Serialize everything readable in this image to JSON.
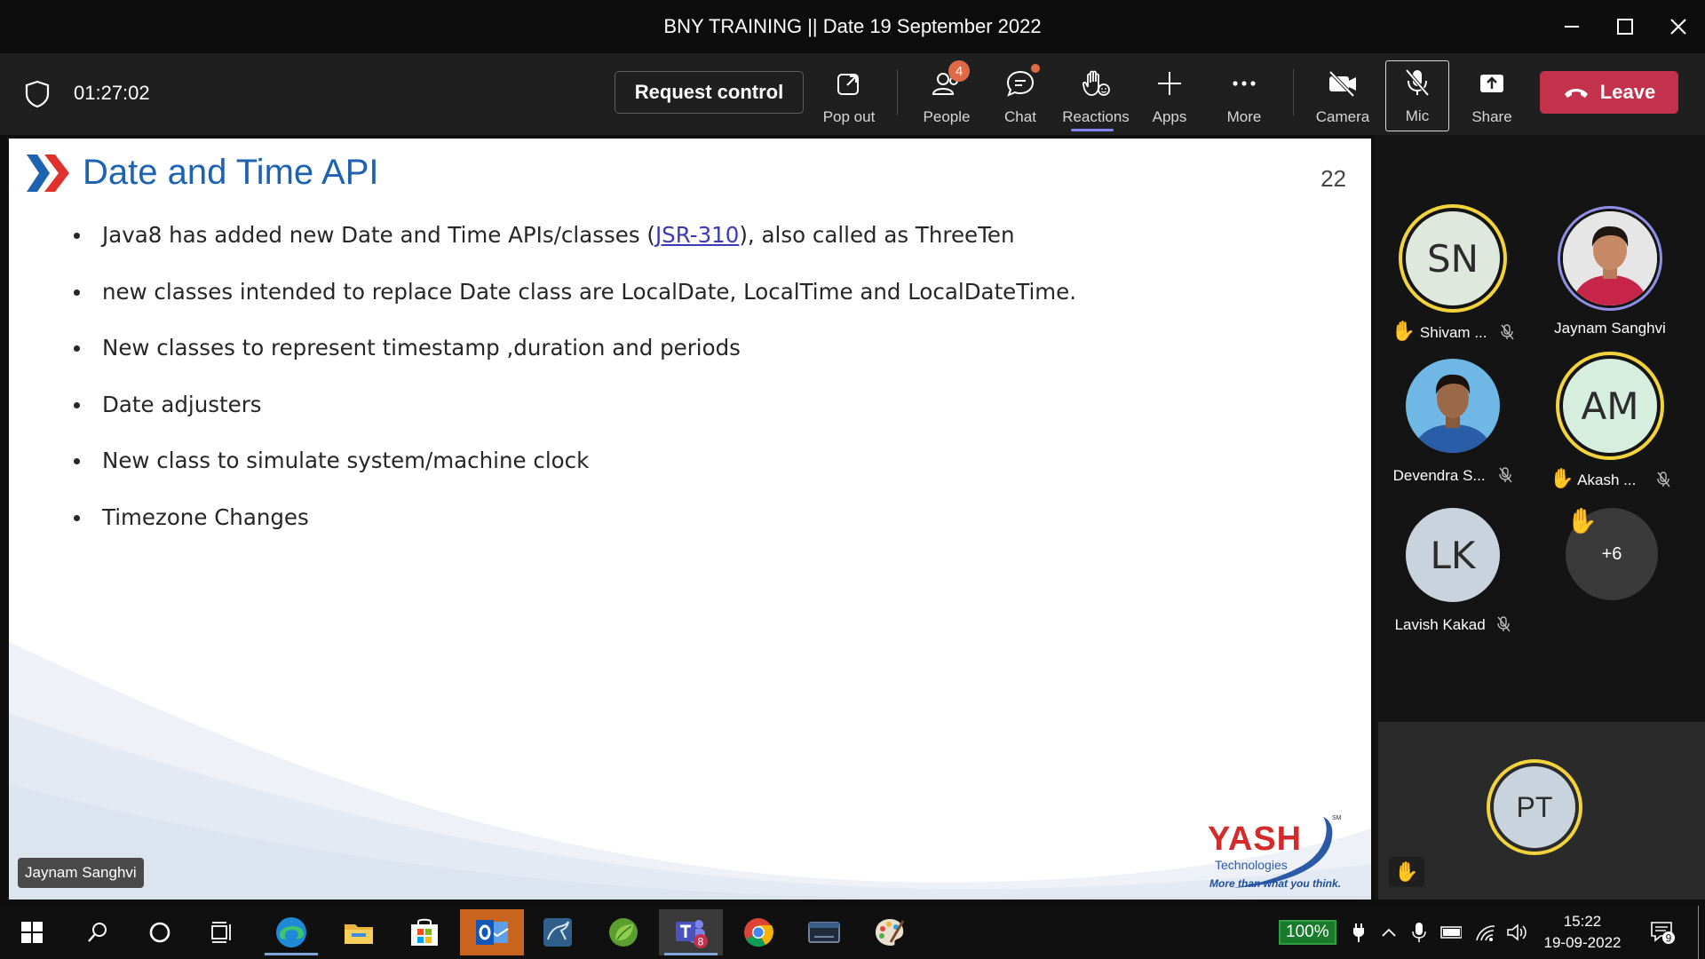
{
  "window": {
    "title": "BNY TRAINING || Date 19 September 2022"
  },
  "toolbar": {
    "timer": "01:27:02",
    "request_control": "Request control",
    "items": [
      {
        "label": "Pop out",
        "icon": "pop-out-icon"
      },
      {
        "label": "People",
        "icon": "people-icon",
        "badge": "4"
      },
      {
        "label": "Chat",
        "icon": "chat-icon"
      },
      {
        "label": "Reactions",
        "icon": "reactions-icon"
      },
      {
        "label": "Apps",
        "icon": "apps-icon"
      },
      {
        "label": "More",
        "icon": "more-icon"
      },
      {
        "label": "Camera",
        "icon": "camera-off-icon"
      },
      {
        "label": "Mic",
        "icon": "mic-off-icon"
      },
      {
        "label": "Share",
        "icon": "share-icon"
      }
    ],
    "leave": "Leave"
  },
  "slide": {
    "title": "Date and Time API",
    "number": "22",
    "bullets": [
      {
        "before": "Java8 has added new Date and Time APIs/classes (",
        "link": "JSR-310",
        "after": "), also called as ThreeTen"
      },
      {
        "text": "new classes intended to replace Date class are LocalDate, LocalTime and LocalDateTime."
      },
      {
        "text": "New classes to represent timestamp ,duration and periods"
      },
      {
        "text": "Date adjusters"
      },
      {
        "text": "New class to simulate system/machine clock"
      },
      {
        "text": "Timezone Changes"
      }
    ],
    "logo": {
      "name": "YASH",
      "sub": "Technologies",
      "tagline": "More than what you think.",
      "mark": "SM"
    },
    "presenter": "Jaynam Sanghvi"
  },
  "participants": [
    {
      "initials": "SN",
      "name": "Shivam ...",
      "hand_raised": true,
      "muted": true,
      "ring": "#f3d33b",
      "bg": "#dfe8dc"
    },
    {
      "initials": "",
      "name": "Jaynam Sanghvi",
      "hand_raised": false,
      "muted": false,
      "ring": "#8f8fe6",
      "photo": true
    },
    {
      "initials": "",
      "name": "Devendra S...",
      "hand_raised": false,
      "muted": true,
      "photo": true
    },
    {
      "initials": "AM",
      "name": "Akash ...",
      "hand_raised": true,
      "muted": true,
      "ring": "#f3d33b",
      "bg": "#d6eedd"
    },
    {
      "initials": "LK",
      "name": "Lavish Kakad",
      "hand_raised": false,
      "muted": true,
      "bg": "#c9d3dd"
    }
  ],
  "overflow": {
    "label": "+6",
    "hand_raised": true
  },
  "self_view": {
    "initials": "PT",
    "hand_raised": true
  },
  "taskbar": {
    "apps": [
      "start-icon",
      "search-icon",
      "cortana-icon",
      "task-view-icon",
      "edge-icon",
      "file-explorer-icon",
      "store-icon",
      "outlook-icon",
      "mysql-workbench-icon",
      "spring-tool-suite-icon",
      "teams-icon",
      "chrome-icon",
      "mysql-icon",
      "paint-icon"
    ],
    "teams_badge": "8",
    "battery": "100%",
    "time": "15:22",
    "date": "19-09-2022",
    "notifications": "9"
  }
}
